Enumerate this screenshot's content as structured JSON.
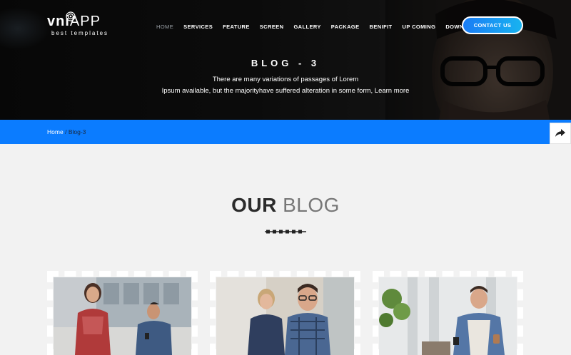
{
  "header": {
    "logo_text_bold": "vni",
    "logo_text_light": "APP",
    "logo_tagline": "best templates",
    "nav": [
      {
        "label": "HOME",
        "active": true
      },
      {
        "label": "SERVICES",
        "active": false
      },
      {
        "label": "FEATURE",
        "active": false
      },
      {
        "label": "SCREEN",
        "active": false
      },
      {
        "label": "GALLERY",
        "active": false
      },
      {
        "label": "PACKAGE",
        "active": false
      },
      {
        "label": "BENIFIT",
        "active": false
      },
      {
        "label": "UP COMING",
        "active": false
      },
      {
        "label": "DOWNLOAD APP",
        "active": false
      }
    ],
    "contact_label": "CONTACT US"
  },
  "hero": {
    "title": "BLOG - 3",
    "text_line1": "There are many variations of passages of Lorem",
    "text_line2": "Ipsum available, but the majorityhave suffered alteration in some form, Learn more"
  },
  "breadcrumb": {
    "home": "Home",
    "separator": "/",
    "current": "Blog-3"
  },
  "section": {
    "title_bold": "OUR",
    "title_light": "BLOG"
  },
  "colors": {
    "accent_blue": "#0b7cff",
    "button_gradient_start": "#1a7cf5",
    "button_gradient_end": "#18b3f0",
    "page_bg": "#f2f2f2"
  },
  "icons": {
    "share": "share-arrow-icon",
    "logo_mark": "target-icon"
  }
}
